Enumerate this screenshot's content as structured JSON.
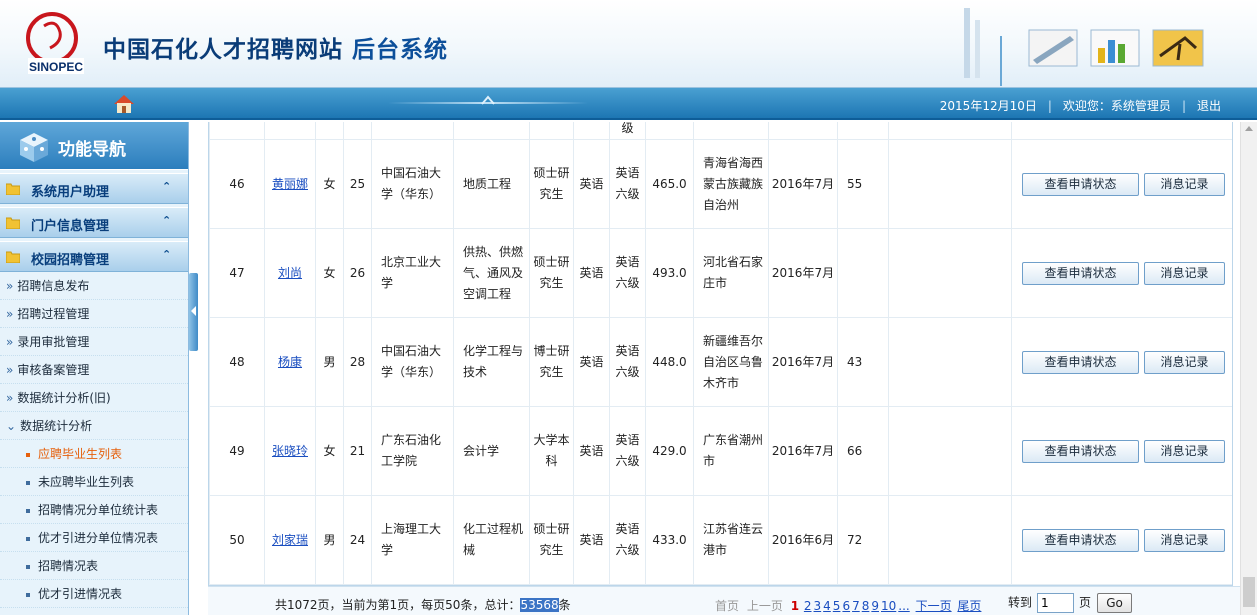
{
  "header": {
    "title_main": "中国石化人才招聘网站",
    "title_sub": "后台系统",
    "logo_text": "SINOPEC"
  },
  "navbar": {
    "date": "2015年12月10日",
    "welcome": "欢迎您：系统管理员",
    "logout": "退出"
  },
  "sidebar": {
    "title": "功能导航",
    "groups": [
      {
        "label": "系统用户助理"
      },
      {
        "label": "门户信息管理"
      },
      {
        "label": "校园招聘管理"
      }
    ],
    "items": [
      {
        "label": "招聘信息发布"
      },
      {
        "label": "招聘过程管理"
      },
      {
        "label": "录用审批管理"
      },
      {
        "label": "审核备案管理"
      },
      {
        "label": "数据统计分析(旧)"
      },
      {
        "label": "数据统计分析"
      }
    ],
    "subitems": [
      {
        "label": "应聘毕业生列表"
      },
      {
        "label": "未应聘毕业生列表"
      },
      {
        "label": "招聘情况分单位统计表"
      },
      {
        "label": "优才引进分单位情况表"
      },
      {
        "label": "招聘情况表"
      },
      {
        "label": "优才引进情况表"
      }
    ]
  },
  "table": {
    "partial_row": {
      "lang_level": "级"
    },
    "rows": [
      {
        "no": "46",
        "name": "黄丽娜",
        "gender": "女",
        "age": "25",
        "school": "中国石油大学（华东）",
        "major": "地质工程",
        "degree": "硕士研究生",
        "lang": "英语",
        "lang_level": "英语六级",
        "score": "465.0",
        "origin": "青海省海西蒙古族藏族自治州",
        "grad": "2016年7月",
        "count": "55"
      },
      {
        "no": "47",
        "name": "刘尚",
        "gender": "女",
        "age": "26",
        "school": "北京工业大学",
        "major": "供热、供燃气、通风及空调工程",
        "degree": "硕士研究生",
        "lang": "英语",
        "lang_level": "英语六级",
        "score": "493.0",
        "origin": "河北省石家庄市",
        "grad": "2016年7月",
        "count": ""
      },
      {
        "no": "48",
        "name": "杨康",
        "gender": "男",
        "age": "28",
        "school": "中国石油大学（华东）",
        "major": "化学工程与技术",
        "degree": "博士研究生",
        "lang": "英语",
        "lang_level": "英语六级",
        "score": "448.0",
        "origin": "新疆维吾尔自治区乌鲁木齐市",
        "grad": "2016年7月",
        "count": "43"
      },
      {
        "no": "49",
        "name": "张晓玲",
        "gender": "女",
        "age": "21",
        "school": "广东石油化工学院",
        "major": "会计学",
        "degree": "大学本科",
        "lang": "英语",
        "lang_level": "英语六级",
        "score": "429.0",
        "origin": "广东省潮州市",
        "grad": "2016年7月",
        "count": "66"
      },
      {
        "no": "50",
        "name": "刘家瑞",
        "gender": "男",
        "age": "24",
        "school": "上海理工大学",
        "major": "化工过程机械",
        "degree": "硕士研究生",
        "lang": "英语",
        "lang_level": "英语六级",
        "score": "433.0",
        "origin": "江苏省连云港市",
        "grad": "2016年6月",
        "count": "72"
      }
    ],
    "btn_status": "查看申请状态",
    "btn_msg": "消息记录"
  },
  "pager": {
    "summary_pre": "共1072页，当前为第1页，每页50条，总计：",
    "total": "53568",
    "summary_post": "条",
    "first": "首页",
    "prev": "上一页",
    "current": "1",
    "pages": [
      "2",
      "3",
      "4",
      "5",
      "6",
      "7",
      "8",
      "9",
      "10"
    ],
    "ellipsis": "...",
    "next": "下一页",
    "last": "尾页",
    "goto_label": "转到",
    "goto_value": "1",
    "page_unit": "页",
    "go": "Go"
  }
}
